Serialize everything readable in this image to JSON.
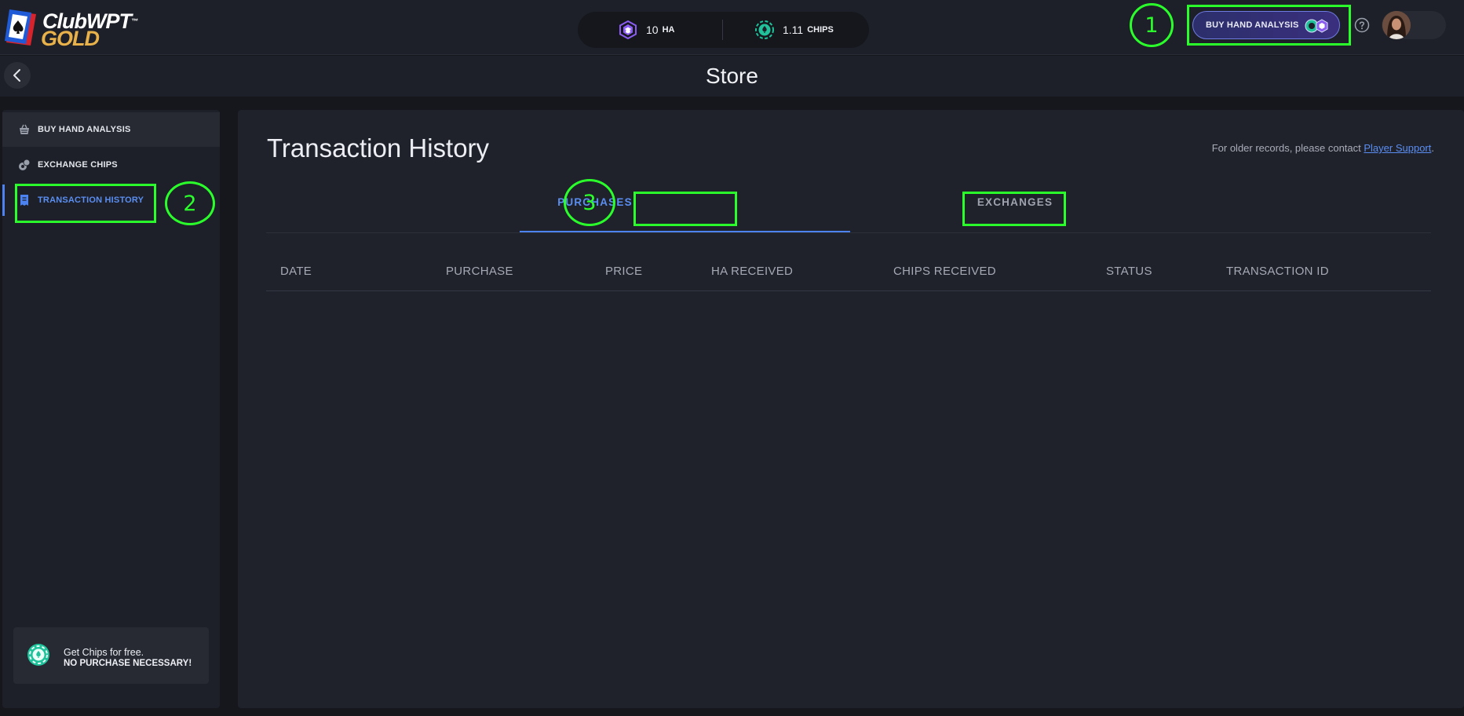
{
  "header": {
    "logo": {
      "line1": "ClubWPT",
      "tm": "™",
      "line2": "GOLD"
    },
    "balance": {
      "ha": {
        "value": "10",
        "unit": "HA"
      },
      "chips": {
        "value": "1.11",
        "unit": "CHIPS"
      }
    },
    "buy_button_label": "BUY HAND ANALYSIS",
    "help_icon": "question-circle-icon"
  },
  "page": {
    "title": "Store"
  },
  "sidebar": {
    "items": [
      {
        "label": "BUY HAND ANALYSIS",
        "icon": "basket-icon"
      },
      {
        "label": "EXCHANGE CHIPS",
        "icon": "coins-icon"
      },
      {
        "label": "TRANSACTION HISTORY",
        "icon": "receipt-icon"
      }
    ],
    "promo": {
      "line1": "Get Chips for free.",
      "line2": "NO PURCHASE NECESSARY!"
    }
  },
  "main": {
    "title": "Transaction History",
    "support_prefix": "For older records, please contact ",
    "support_link": "Player Support",
    "support_suffix": ".",
    "tabs": [
      {
        "label": "PURCHASES",
        "active": true
      },
      {
        "label": "EXCHANGES",
        "active": false
      }
    ],
    "columns": [
      "DATE",
      "PURCHASE",
      "PRICE",
      "HA RECEIVED",
      "CHIPS RECEIVED",
      "STATUS",
      "TRANSACTION ID"
    ]
  },
  "annotations": {
    "labels": [
      "1",
      "2",
      "3"
    ]
  },
  "colors": {
    "accent_blue": "#4c83f0",
    "annotation_green": "#2bff2b",
    "gold": "#e8b14a",
    "ha_purple": "#8a5cf0",
    "chips_green": "#1fc29a"
  }
}
